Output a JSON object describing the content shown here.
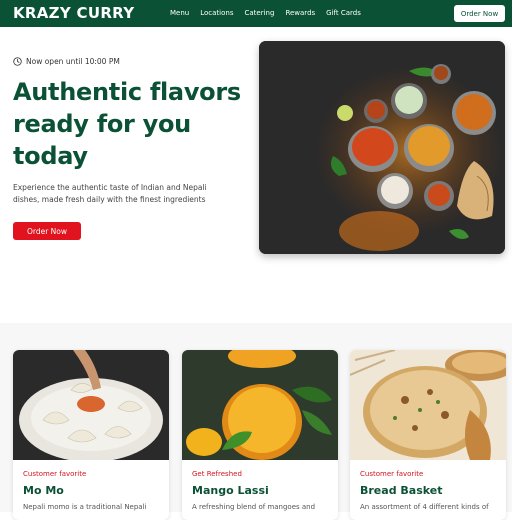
{
  "nav": {
    "logo": "KRAZY CURRY",
    "links": [
      "Menu",
      "Locations",
      "Catering",
      "Rewards",
      "Gift Cards"
    ],
    "order_label": "Order Now"
  },
  "hero": {
    "status": "Now open until 10:00 PM",
    "headline": "Authentic flavors ready for you today",
    "subtext": "Experience the authentic taste of Indian and Nepali dishes, made fresh daily with the finest ingredients",
    "cta_label": "Order Now"
  },
  "cards": [
    {
      "tag": "Customer favorite",
      "title": "Mo Mo",
      "desc": "Nepali momo is a traditional Nepali"
    },
    {
      "tag": "Get Refreshed",
      "title": "Mango Lassi",
      "desc": "A refreshing blend of mangoes and"
    },
    {
      "tag": "Customer favorite",
      "title": "Bread Basket",
      "desc": "An assortment of 4 different kinds of"
    }
  ],
  "colors": {
    "brand_green": "#0b5135",
    "accent_red": "#e0131e"
  }
}
